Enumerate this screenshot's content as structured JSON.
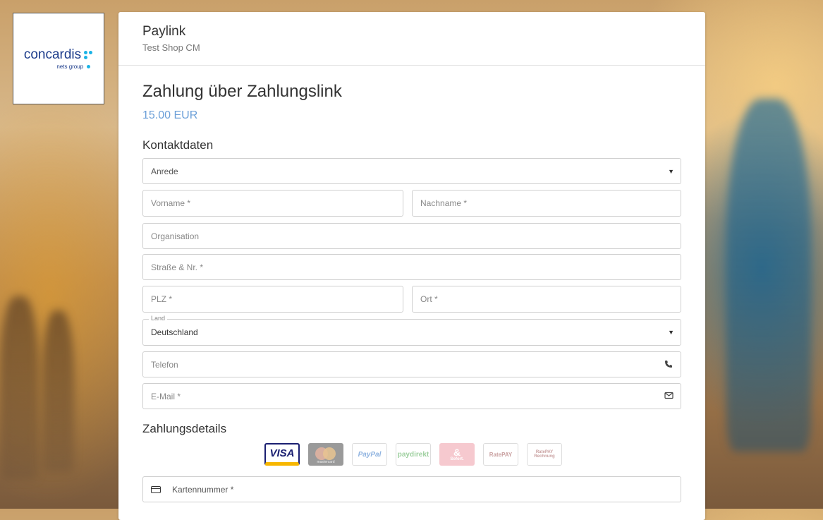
{
  "logo": {
    "word": "concardis",
    "sub": "nets group"
  },
  "header": {
    "title": "Paylink",
    "shop": "Test Shop CM"
  },
  "main": {
    "heading": "Zahlung über Zahlungslink",
    "amount": "15.00 EUR",
    "contact_section": "Kontaktdaten",
    "payment_section": "Zahlungsdetails"
  },
  "form": {
    "salutation": "Anrede",
    "firstname": "Vorname *",
    "lastname": "Nachname *",
    "organisation": "Organisation",
    "street": "Straße & Nr. *",
    "zip": "PLZ *",
    "city": "Ort *",
    "country_label": "Land",
    "country_value": "Deutschland",
    "phone": "Telefon",
    "email": "E-Mail *",
    "card_number": "Kartennummer *"
  },
  "payment_methods": [
    {
      "name": "visa",
      "label": "VISA"
    },
    {
      "name": "mastercard",
      "label": "mastercard"
    },
    {
      "name": "paypal",
      "label": "PayPal"
    },
    {
      "name": "paydirekt",
      "label": "paydirekt"
    },
    {
      "name": "sofort",
      "label": "Sofort."
    },
    {
      "name": "ratepay",
      "label": "RatePAY"
    },
    {
      "name": "ratepay-rechnung",
      "label": "RatePAY Rechnung"
    }
  ],
  "colors": {
    "amount": "#6b9fd8",
    "logo_blue": "#1a3a8a",
    "logo_dot": "#1ab3e6"
  },
  "icons": {
    "phone": "phone-icon",
    "email": "envelope-icon",
    "card": "credit-card-icon",
    "dropdown": "caret-down-icon"
  }
}
